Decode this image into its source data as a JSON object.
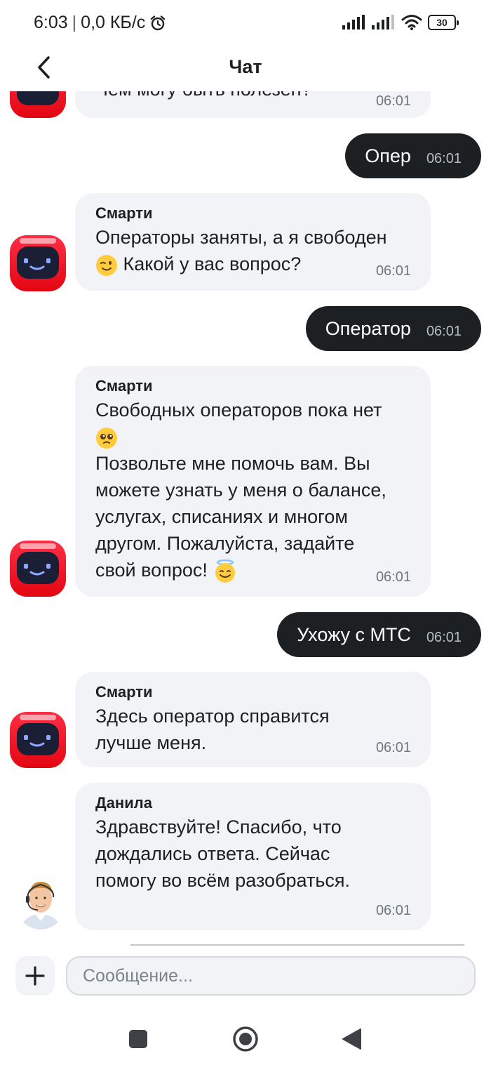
{
  "status_bar": {
    "time": "6:03",
    "separator": "|",
    "network_speed": "0,0 КБ/с",
    "battery": "30"
  },
  "header": {
    "title": "Чат"
  },
  "chat": {
    "partial_top": {
      "text": "Чем могу быть полезен?",
      "time": "06:01"
    },
    "messages": [
      {
        "text": "Опер",
        "time": "06:01"
      },
      {
        "sender": "Смарти",
        "line1": "Операторы заняты, а я свободен",
        "line2": "Какой у вас вопрос?",
        "time": "06:01"
      },
      {
        "text": "Оператор",
        "time": "06:01"
      },
      {
        "sender": "Смарти",
        "line1": "Свободных операторов пока нет",
        "line3": "Позвольте мне помочь вам. Вы",
        "line4": "можете узнать у меня о балансе,",
        "line5": "услугах, списаниях и многом",
        "line6": "другом. Пожалуйста, задайте",
        "line7": "свой вопрос!",
        "time": "06:01"
      },
      {
        "text": "Ухожу с МТС",
        "time": "06:01"
      },
      {
        "sender": "Смарти",
        "line1": "Здесь оператор справится",
        "line2": "лучше меня.",
        "time": "06:01"
      },
      {
        "sender": "Данила",
        "line1": "Здравствуйте! Спасибо, что",
        "line2": "дождались ответа. Сейчас",
        "line3": "помогу во всём разобраться.",
        "time": "06:01"
      }
    ]
  },
  "composer": {
    "placeholder": "Сообщение..."
  },
  "colors": {
    "accent_red": "#e30611",
    "outgoing_bubble": "#1d2023",
    "incoming_bubble": "#f2f3f7"
  },
  "icons": {
    "back": "chevron-left-icon",
    "attach": "plus-icon",
    "nav_recents": "square-icon",
    "nav_home": "circle-icon",
    "nav_back": "triangle-left-icon"
  }
}
